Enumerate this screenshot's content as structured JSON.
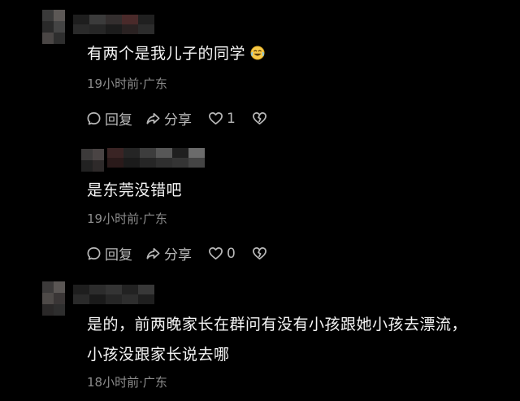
{
  "comments": [
    {
      "text": "有两个是我儿子的同学",
      "emoji": "laughing-tears-emoji",
      "meta": "19小时前·广东",
      "actions": {
        "reply": "回复",
        "share": "分享",
        "likes": "1"
      }
    },
    {
      "text": "是东莞没错吧",
      "meta": "19小时前·广东",
      "actions": {
        "reply": "回复",
        "share": "分享",
        "likes": "0"
      }
    },
    {
      "text_line1": "是的，前两晚家长在群问有没有小孩跟她小孩去漂流，",
      "text_line2": "小孩没跟家长说去哪",
      "meta": "18小时前·广东"
    }
  ],
  "icons": {
    "reply": "reply-bubble-icon",
    "share": "share-arrow-icon",
    "like": "heart-icon",
    "dislike": "broken-heart-icon"
  },
  "colors": {
    "background": "#000000",
    "text": "#f5f5f5",
    "meta": "#8c8c8c",
    "actions": "#b8b8b8"
  }
}
